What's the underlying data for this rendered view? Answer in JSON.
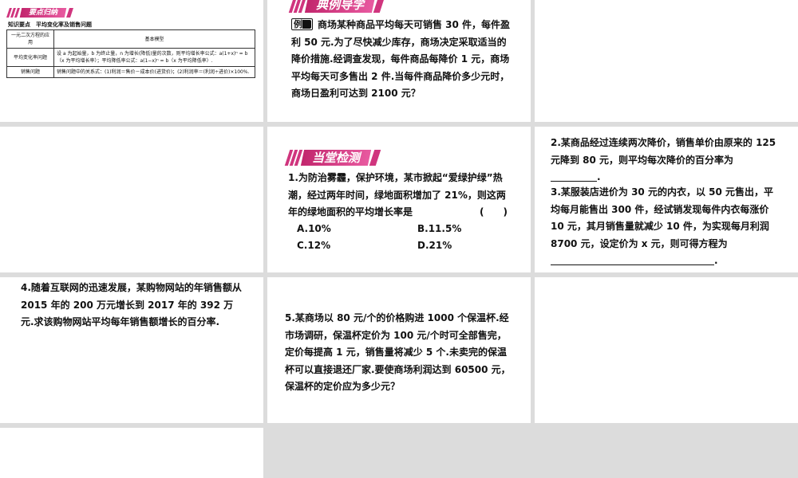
{
  "slide1": {
    "banner": "要点归纳",
    "knowledge_point": "知识要点　平均变化率及销售问题",
    "table": {
      "header_left": "一元二次方程的应用",
      "header_right": "基本模型",
      "rows": [
        {
          "name": "平均变化率问题",
          "text": "设 a 为起始量，b 为终止量，n 为增长(降低)量的次数，则平均增长率公式：a(1+x)ⁿ = b（x 为平均增长率）；平均降低率公式：a(1−x)ⁿ = b（x 为平均降低率）."
        },
        {
          "name": "销售问题",
          "text": "销售问题中的关系式：(1)利润＝售价－成本价(进货价)；(2)利润率＝(利润÷进价)×100%."
        }
      ]
    }
  },
  "slide2": {
    "banner": "典例导学",
    "tag": "例",
    "text": "商场某种商品平均每天可销售 30 件，每件盈利 50 元.为了尽快减少库存，商场决定采取适当的降价措施.经调查发现，每件商品每降价 1 元，商场平均每天可多售出 2 件.当每件商品降价多少元时，商场日盈利可达到 2100 元？"
  },
  "slide5": {
    "banner": "当堂检测",
    "q1": {
      "text": "1.为防治雾霾，保护环境，某市掀起“爱绿护绿”热潮，经过两年时间，绿地面积增加了 21%，则这两年的绿地面积的平均增长率是",
      "bracket": "(　　)",
      "options": {
        "A": "A.10%",
        "B": "B.11.5%",
        "C": "C.12%",
        "D": "D.21%"
      }
    }
  },
  "slide6": {
    "q2_text": "2.某商品经过连续两次降价，销售单价由原来的 125 元降到 80 元，则平均每次降价的百分率为",
    "q2_end": ".",
    "q3_text": "3.某服装店进价为 30 元的内衣，以 50 元售出，平均每月能售出 300 件，经试销发现每件内衣每涨价 10 元，其月销售量就减少 10 件，为实现每月利润 8700 元，设定价为 x 元，则可得方程为",
    "q3_end": "."
  },
  "slide7": {
    "q4_text": "4.随着互联网的迅速发展，某购物网站的年销售额从 2015 年的 200 万元增长到 2017 年的 392 万元.求该购物网站平均每年销售额增长的百分率."
  },
  "slide8": {
    "q5_text": "5.某商场以 80 元/个的价格购进 1000 个保温杯.经市场调研，保温杯定价为 100 元/个时可全部售完，定价每提高 1 元，销售量将减少 5 个.未卖完的保温杯可以直接退还厂家.要使商场利润达到 60500 元，保温杯的定价应为多少元？"
  }
}
